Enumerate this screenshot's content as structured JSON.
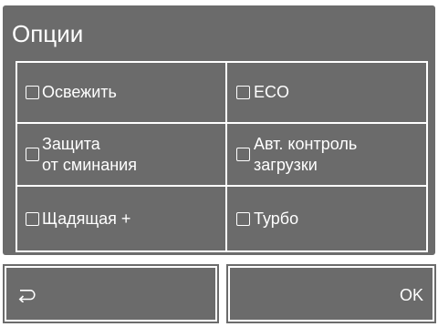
{
  "header": {
    "title": "Опции"
  },
  "options": {
    "refresh": "Освежить",
    "eco": "ECO",
    "anti_crease_line1": "Защита",
    "anti_crease_line2": "от сминания",
    "auto_load_line1": "Авт. контроль",
    "auto_load_line2": "загрузки",
    "gentle_plus": "Щадящая +",
    "turbo": "Турбо"
  },
  "footer": {
    "back_icon": "return-arrow-icon",
    "ok_label": "OK"
  },
  "colors": {
    "panel": "#6b6b6b",
    "text": "#ffffff",
    "background": "#ffffff"
  }
}
